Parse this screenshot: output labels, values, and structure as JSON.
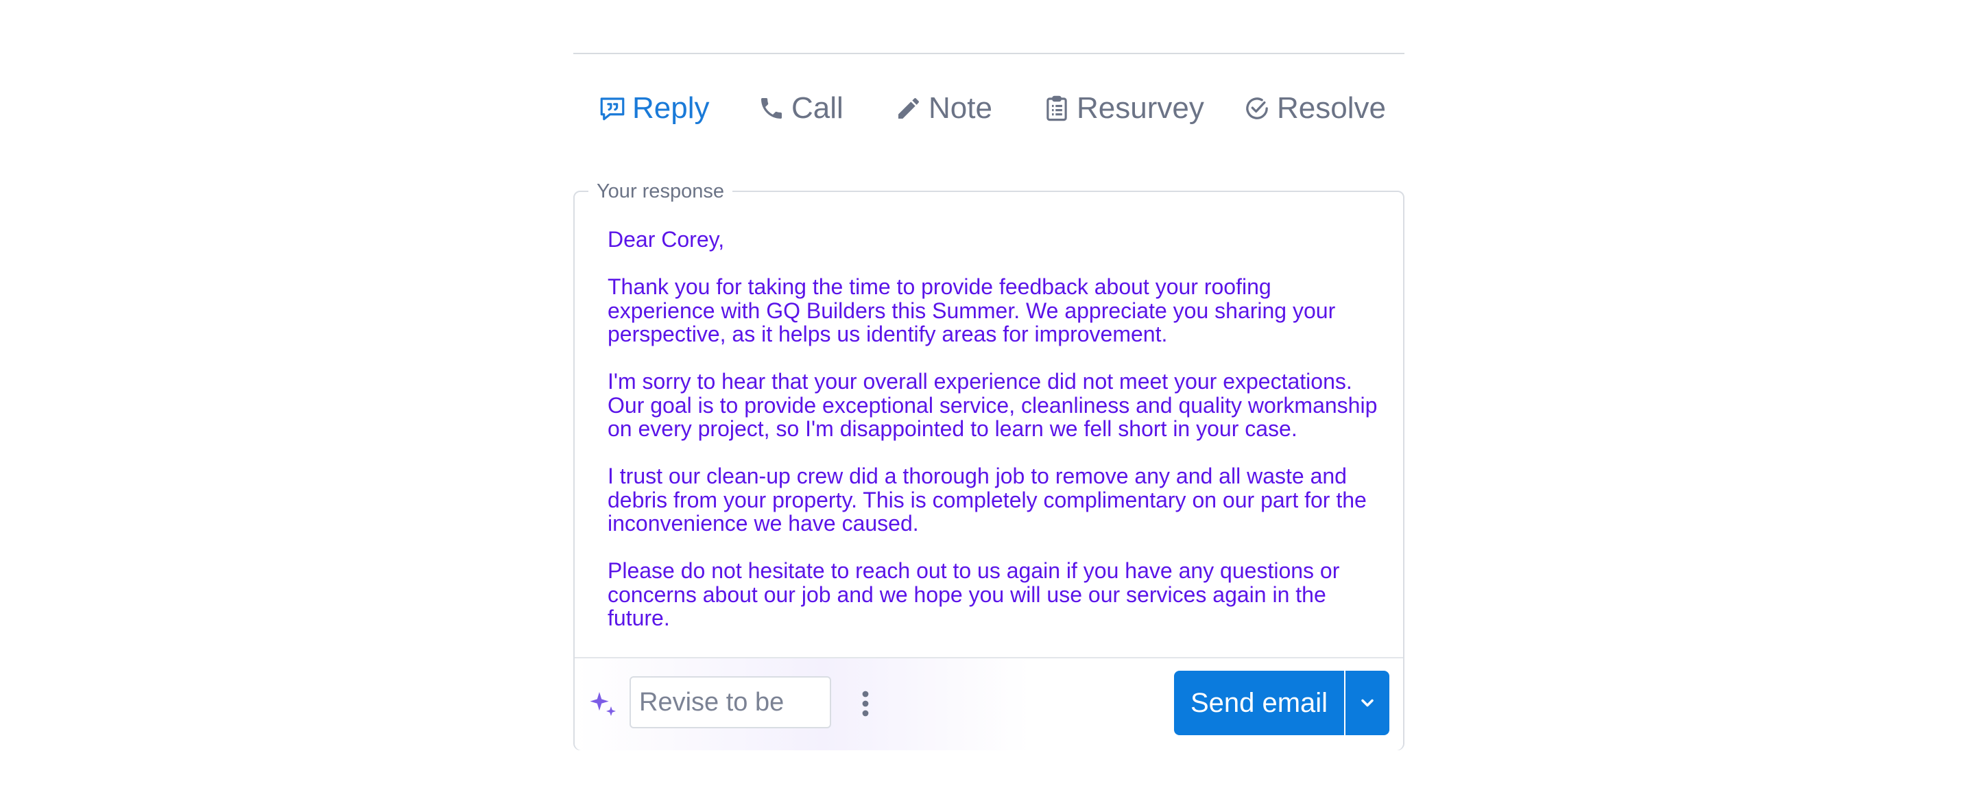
{
  "actions": [
    {
      "label": "Reply",
      "icon": "reply-icon",
      "active": true
    },
    {
      "label": "Call",
      "icon": "phone-icon",
      "active": false
    },
    {
      "label": "Note",
      "icon": "pencil-icon",
      "active": false
    },
    {
      "label": "Resurvey",
      "icon": "clipboard-icon",
      "active": false
    },
    {
      "label": "Resolve",
      "icon": "check-circle-icon",
      "active": false
    }
  ],
  "response": {
    "legend": "Your response",
    "paragraphs": [
      "Dear Corey,",
      "Thank you for taking the time to provide feedback about your roofing experience with GQ Builders this Summer. We appreciate you sharing your perspective, as it helps us identify areas for improvement.",
      "I'm sorry to hear that your overall experience did not meet your expectations. Our goal is to provide exceptional service, cleanliness and quality workmanship on every project, so I'm disappointed to learn we fell short in your case.",
      "I trust our clean-up crew did a thorough job to remove any and all waste and debris from your property. This is completely complimentary on our part for the inconvenience we have caused.",
      "Please do not hesitate to reach out to us again if you have any questions or concerns about our job and we hope you will use our services again in the future."
    ]
  },
  "footer": {
    "revise_placeholder": "Revise to be",
    "send_label": "Send email"
  },
  "colors": {
    "accent": "#0b7bdd",
    "active_tab": "#1a7ad8",
    "response_text": "#5a14e8",
    "muted": "#6b7386",
    "sparkle": "#7c5ce6"
  }
}
